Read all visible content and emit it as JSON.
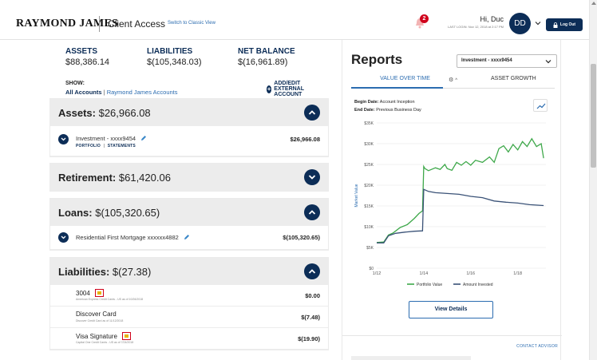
{
  "header": {
    "logo": "RAYMOND JAMES",
    "client_access": "Client Access",
    "switch_link": "Switch to Classic View",
    "notification_count": "2",
    "greeting": "Hi, Duc",
    "last_login": "LAST LOGIN: Nov 12, 2018 at 2:17 PM",
    "avatar_initials": "DD",
    "logout_label": "Log Out"
  },
  "summary": {
    "assets_label": "ASSETS",
    "assets_value": "$88,386.14",
    "liabilities_label": "LIABILITIES",
    "liabilities_value": "$(105,348.03)",
    "net_label": "NET BALANCE",
    "net_value": "$(16,961.89)"
  },
  "show": {
    "label": "SHOW:",
    "all_accounts": "All Accounts",
    "separator": "|",
    "rj_accounts": "Raymond James Accounts",
    "add_external": "ADD/EDIT EXTERNAL ACCOUNT"
  },
  "sections": {
    "assets": {
      "title": "Assets:",
      "amount": "$26,966.08",
      "accounts": [
        {
          "name": "Investment - xxxx9454",
          "portfolio": "PORTFOLIO",
          "sep": "|",
          "statements": "STATEMENTS",
          "amount": "$26,966.08"
        }
      ]
    },
    "retirement": {
      "title": "Retirement:",
      "amount": "$61,420.06"
    },
    "loans": {
      "title": "Loans:",
      "amount": "$(105,320.65)",
      "accounts": [
        {
          "name": "Residential First Mortgage xxxxxx4882",
          "amount": "$(105,320.65)"
        }
      ]
    },
    "liabilities": {
      "title": "Liabilities:",
      "amount": "$(27.38)",
      "items": [
        {
          "name": "3004",
          "sub": "American Express Credit Cards - US as of 10/26/2018",
          "amount": "$0.00"
        },
        {
          "name": "Discover Card",
          "sub": "Discover Credit Card as of 11/12/2018",
          "amount": "$(7.48)"
        },
        {
          "name": "Visa Signature",
          "sub": "Capital One Credit Cards - US as of 7/24/2018",
          "amount": "$(19.90)"
        }
      ]
    }
  },
  "reports": {
    "title": "Reports",
    "account_select": "Investment - xxxx9454",
    "tab_value": "VALUE OVER TIME",
    "tab_growth": "ASSET GROWTH",
    "begin_label": "Begin Date:",
    "begin_value": "Account Inception",
    "end_label": "End Date:",
    "end_value": "Previous Business Day",
    "view_details": "View Details",
    "contact_advisor": "CONTACT ADVISOR"
  },
  "colors": {
    "navy": "#0c2d57",
    "link_blue": "#2b6cb0",
    "portfolio_green": "#3ea84a",
    "invested_navy": "#3a5277",
    "alert_red": "#d0021b"
  },
  "chart_data": {
    "type": "line",
    "ylabel": "Market Value",
    "ylim": [
      0,
      35000
    ],
    "y_ticks": [
      0,
      5000,
      10000,
      15000,
      20000,
      25000,
      30000,
      35000
    ],
    "y_tick_labels": [
      "$0",
      "$5K",
      "$10K",
      "$15K",
      "$20K",
      "$25K",
      "$30K",
      "$35K"
    ],
    "x_tick_labels": [
      "1/12",
      "1/14",
      "1/16",
      "1/18"
    ],
    "x_ticks": [
      2012,
      2014,
      2016,
      2018
    ],
    "xlim": [
      2012,
      2019.2
    ],
    "grid": true,
    "legend": "bottom",
    "series": [
      {
        "name": "Portfolio Value",
        "color": "#3ea84a",
        "x": [
          2012.0,
          2012.3,
          2012.5,
          2012.7,
          2013.0,
          2013.3,
          2013.6,
          2013.8,
          2013.95,
          2014.0,
          2014.05,
          2014.2,
          2014.5,
          2014.7,
          2014.9,
          2015.0,
          2015.2,
          2015.4,
          2015.6,
          2015.8,
          2016.0,
          2016.2,
          2016.5,
          2016.8,
          2017.0,
          2017.2,
          2017.4,
          2017.6,
          2017.8,
          2018.0,
          2018.2,
          2018.4,
          2018.6,
          2018.8,
          2019.0,
          2019.1
        ],
        "y": [
          6200,
          6300,
          8000,
          8500,
          9800,
          10500,
          12000,
          13200,
          13800,
          24500,
          24000,
          23500,
          24200,
          23800,
          25000,
          24000,
          23600,
          25500,
          24800,
          25700,
          24800,
          26000,
          25500,
          26800,
          25500,
          28800,
          29500,
          28000,
          29800,
          28500,
          30500,
          29300,
          31200,
          29300,
          30000,
          26500
        ]
      },
      {
        "name": "Amount Invested",
        "color": "#3a5277",
        "x": [
          2012.0,
          2012.3,
          2012.5,
          2012.8,
          2013.2,
          2013.6,
          2013.95,
          2014.0,
          2014.2,
          2014.5,
          2015.0,
          2015.5,
          2016.0,
          2016.5,
          2017.0,
          2017.5,
          2018.0,
          2018.5,
          2019.1
        ],
        "y": [
          6100,
          6100,
          7800,
          8400,
          8700,
          8900,
          9000,
          19000,
          18500,
          18200,
          18000,
          17800,
          17300,
          17000,
          16200,
          15900,
          15700,
          15300,
          15100
        ]
      }
    ]
  }
}
